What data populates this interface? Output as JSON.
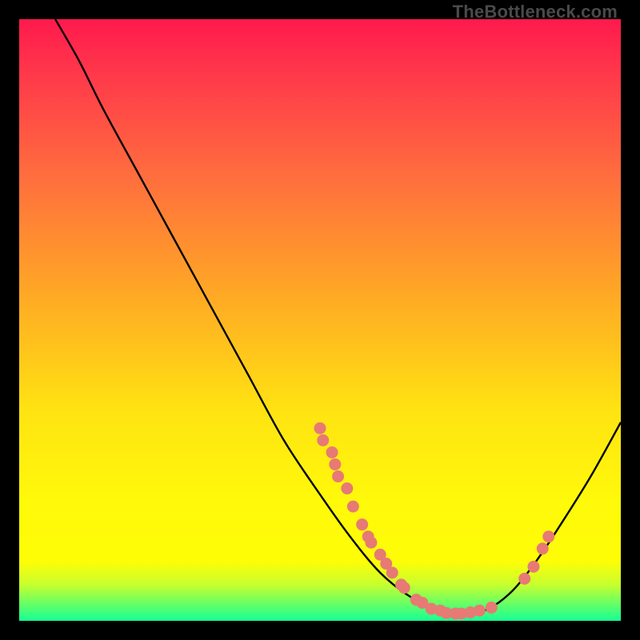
{
  "watermark": "TheBottleneck.com",
  "chart_data": {
    "type": "line",
    "title": "",
    "xlabel": "",
    "ylabel": "",
    "xlim": [
      0,
      100
    ],
    "ylim": [
      0,
      100
    ],
    "curve": [
      {
        "x": 6,
        "y": 100
      },
      {
        "x": 10,
        "y": 93
      },
      {
        "x": 14,
        "y": 85
      },
      {
        "x": 20,
        "y": 74
      },
      {
        "x": 26,
        "y": 63
      },
      {
        "x": 32,
        "y": 52
      },
      {
        "x": 38,
        "y": 41
      },
      {
        "x": 44,
        "y": 30
      },
      {
        "x": 50,
        "y": 21
      },
      {
        "x": 55,
        "y": 14
      },
      {
        "x": 60,
        "y": 8
      },
      {
        "x": 65,
        "y": 4
      },
      {
        "x": 70,
        "y": 1.5
      },
      {
        "x": 74,
        "y": 1
      },
      {
        "x": 78,
        "y": 2
      },
      {
        "x": 82,
        "y": 5
      },
      {
        "x": 86,
        "y": 10
      },
      {
        "x": 90,
        "y": 16
      },
      {
        "x": 95,
        "y": 24
      },
      {
        "x": 100,
        "y": 33
      }
    ],
    "points": [
      {
        "x": 50,
        "y": 32
      },
      {
        "x": 50.5,
        "y": 30
      },
      {
        "x": 52,
        "y": 28
      },
      {
        "x": 52.5,
        "y": 26
      },
      {
        "x": 53,
        "y": 24
      },
      {
        "x": 54.5,
        "y": 22
      },
      {
        "x": 55.5,
        "y": 19
      },
      {
        "x": 57,
        "y": 16
      },
      {
        "x": 58,
        "y": 14
      },
      {
        "x": 58.5,
        "y": 13
      },
      {
        "x": 60,
        "y": 11
      },
      {
        "x": 61,
        "y": 9.5
      },
      {
        "x": 62,
        "y": 8
      },
      {
        "x": 63.5,
        "y": 6
      },
      {
        "x": 64,
        "y": 5.5
      },
      {
        "x": 66,
        "y": 3.5
      },
      {
        "x": 67,
        "y": 3
      },
      {
        "x": 68.5,
        "y": 2
      },
      {
        "x": 70,
        "y": 1.7
      },
      {
        "x": 71,
        "y": 1.3
      },
      {
        "x": 72.5,
        "y": 1.2
      },
      {
        "x": 73.5,
        "y": 1.2
      },
      {
        "x": 75,
        "y": 1.4
      },
      {
        "x": 76.5,
        "y": 1.7
      },
      {
        "x": 78.5,
        "y": 2.2
      },
      {
        "x": 84,
        "y": 7
      },
      {
        "x": 85.5,
        "y": 9
      },
      {
        "x": 87,
        "y": 12
      },
      {
        "x": 88,
        "y": 14
      }
    ],
    "colors": {
      "curve": "#000000",
      "points": "#e77a74"
    }
  }
}
